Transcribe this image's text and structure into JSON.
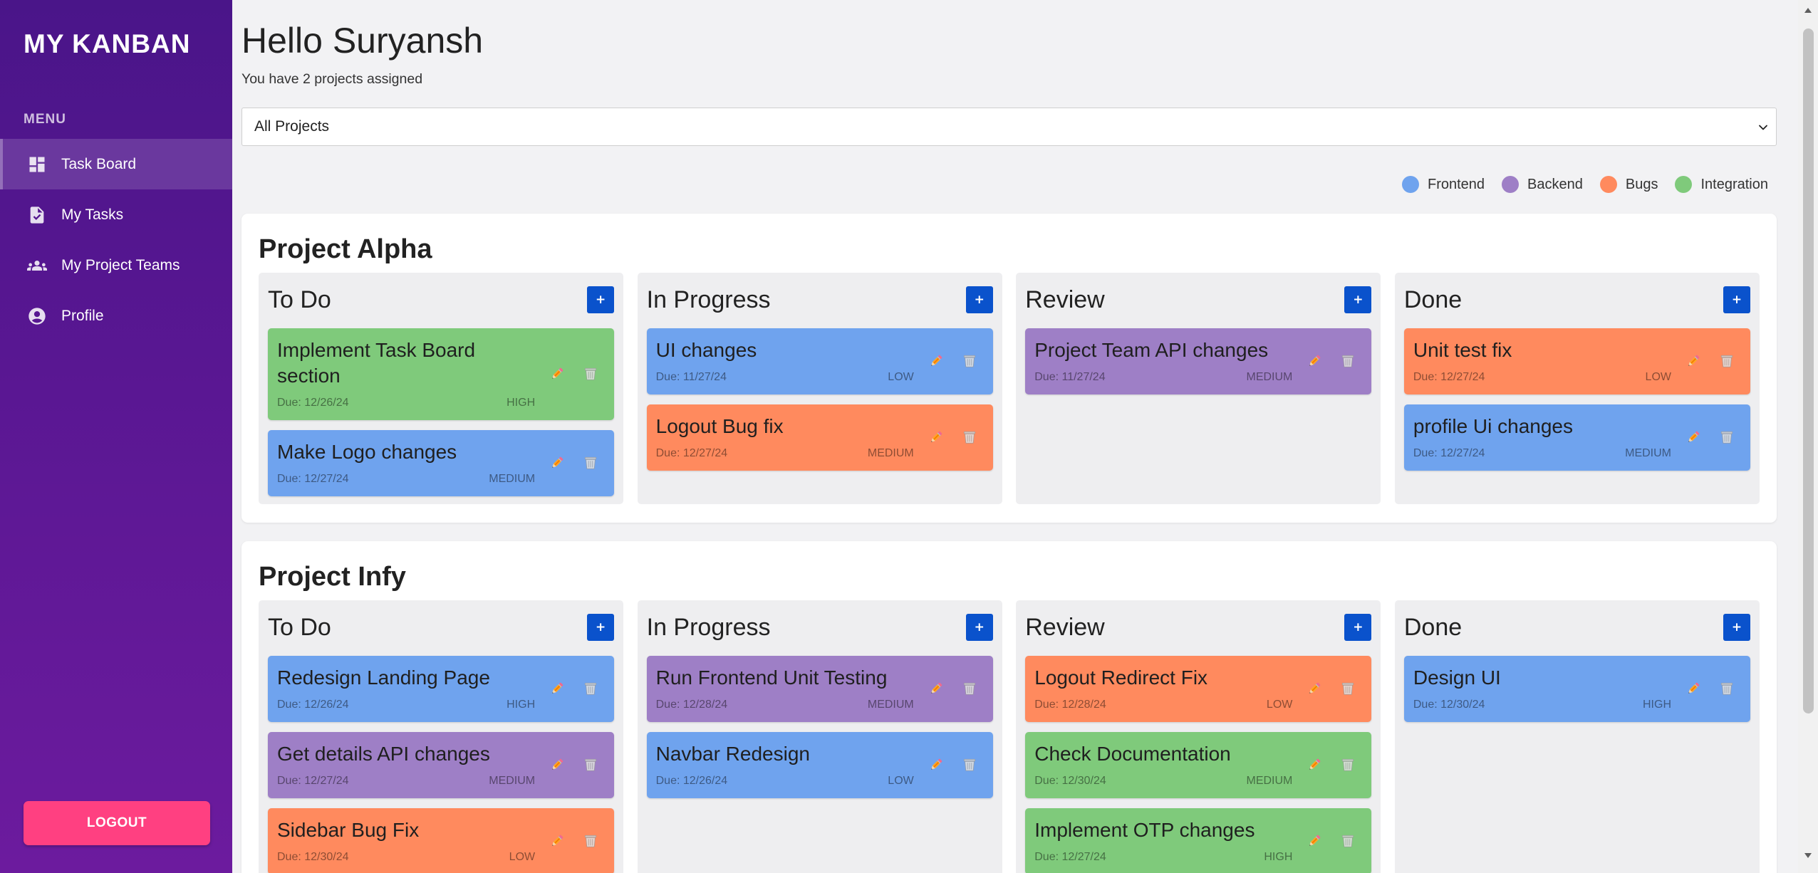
{
  "app": {
    "brand": "MY KANBAN"
  },
  "sidebar": {
    "menu_label": "MENU",
    "items": [
      {
        "label": "Task Board",
        "icon": "dashboard-icon",
        "active": true
      },
      {
        "label": "My Tasks",
        "icon": "task-icon",
        "active": false
      },
      {
        "label": "My Project Teams",
        "icon": "groups-icon",
        "active": false
      },
      {
        "label": "Profile",
        "icon": "account-circle-icon",
        "active": false
      }
    ],
    "logout_label": "LOGOUT"
  },
  "header": {
    "greeting": "Hello Suryansh",
    "subtitle": "You have 2 projects assigned"
  },
  "project_filter": {
    "selected": "All Projects"
  },
  "legend": [
    {
      "label": "Frontend",
      "color": "#6fa3ee"
    },
    {
      "label": "Backend",
      "color": "#9e7fc6"
    },
    {
      "label": "Bugs",
      "color": "#ff8a5e"
    },
    {
      "label": "Integration",
      "color": "#7fca7b"
    }
  ],
  "theme": {
    "sidebar_top": "#4a1589",
    "sidebar_bottom": "#6c1b9e",
    "logout": "#ff4081",
    "accent": "#0a52cc"
  },
  "board_labels": {
    "add_task": "+"
  },
  "projects": [
    {
      "name": "Project Alpha",
      "columns": [
        {
          "title": "To Do",
          "tasks": [
            {
              "title": "Implement Task Board section",
              "due": "Due: 12/26/24",
              "priority": "HIGH",
              "color": "#7fca7b"
            },
            {
              "title": "Make Logo changes",
              "due": "Due: 12/27/24",
              "priority": "MEDIUM",
              "color": "#6fa3ee"
            }
          ]
        },
        {
          "title": "In Progress",
          "tasks": [
            {
              "title": "UI changes",
              "due": "Due: 11/27/24",
              "priority": "LOW",
              "color": "#6fa3ee"
            },
            {
              "title": "Logout Bug fix",
              "due": "Due: 12/27/24",
              "priority": "MEDIUM",
              "color": "#ff8a5e"
            }
          ]
        },
        {
          "title": "Review",
          "tasks": [
            {
              "title": "Project Team API changes",
              "due": "Due: 11/27/24",
              "priority": "MEDIUM",
              "color": "#9e7fc6"
            }
          ]
        },
        {
          "title": "Done",
          "tasks": [
            {
              "title": "Unit test fix",
              "due": "Due: 12/27/24",
              "priority": "LOW",
              "color": "#ff8a5e"
            },
            {
              "title": "profile Ui changes",
              "due": "Due: 12/27/24",
              "priority": "MEDIUM",
              "color": "#6fa3ee"
            }
          ]
        }
      ]
    },
    {
      "name": "Project Infy",
      "columns": [
        {
          "title": "To Do",
          "tasks": [
            {
              "title": "Redesign Landing Page",
              "due": "Due: 12/26/24",
              "priority": "HIGH",
              "color": "#6fa3ee"
            },
            {
              "title": "Get details API changes",
              "due": "Due: 12/27/24",
              "priority": "MEDIUM",
              "color": "#9e7fc6"
            },
            {
              "title": "Sidebar Bug Fix",
              "due": "Due: 12/30/24",
              "priority": "LOW",
              "color": "#ff8a5e"
            }
          ]
        },
        {
          "title": "In Progress",
          "tasks": [
            {
              "title": "Run Frontend Unit Testing",
              "due": "Due: 12/28/24",
              "priority": "MEDIUM",
              "color": "#9e7fc6"
            },
            {
              "title": "Navbar Redesign",
              "due": "Due: 12/26/24",
              "priority": "LOW",
              "color": "#6fa3ee"
            }
          ]
        },
        {
          "title": "Review",
          "tasks": [
            {
              "title": "Logout Redirect Fix",
              "due": "Due: 12/28/24",
              "priority": "LOW",
              "color": "#ff8a5e"
            },
            {
              "title": "Check Documentation",
              "due": "Due: 12/30/24",
              "priority": "MEDIUM",
              "color": "#7fca7b"
            },
            {
              "title": "Implement OTP changes",
              "due": "Due: 12/27/24",
              "priority": "HIGH",
              "color": "#7fca7b"
            }
          ]
        },
        {
          "title": "Done",
          "tasks": [
            {
              "title": "Design UI",
              "due": "Due: 12/30/24",
              "priority": "HIGH",
              "color": "#6fa3ee"
            }
          ]
        }
      ]
    }
  ]
}
